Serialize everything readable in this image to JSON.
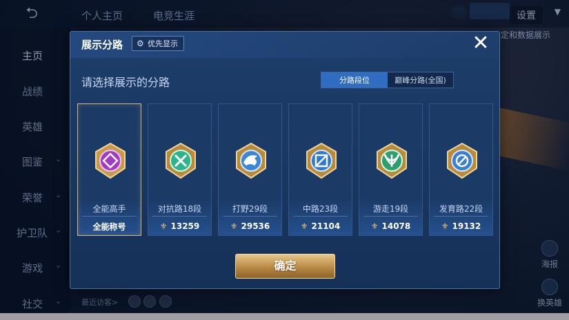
{
  "app": {
    "top_tabs": [
      "个人主页",
      "电竞生涯"
    ],
    "settings_label": "设置",
    "link_text": "定和数据展示",
    "sidebar": [
      {
        "label": "主页",
        "active": true,
        "chevron": false
      },
      {
        "label": "战绩",
        "chevron": false
      },
      {
        "label": "英雄",
        "chevron": false
      },
      {
        "label": "图鉴",
        "chevron": true
      },
      {
        "label": "荣誉",
        "chevron": true
      },
      {
        "label": "护卫队",
        "chevron": true
      },
      {
        "label": "游戏",
        "chevron": true
      },
      {
        "label": "社交",
        "chevron": true
      }
    ],
    "recent_visitors_label": "最近访客>",
    "right_tools": [
      "海报",
      "换英雄"
    ]
  },
  "modal": {
    "title": "展示分路",
    "priority_label": "优先显示",
    "priority_icon": "gear-icon",
    "close_icon": "close-icon",
    "subheading": "请选择展示的分路",
    "toggle": {
      "option_1": "分路段位",
      "option_2": "巅峰分路(全国)",
      "selected": "分路段位"
    },
    "cards": [
      {
        "label": "全能高手",
        "footer": "全能称号",
        "selected": true,
        "emblem_color": "#a23bbf",
        "icon": "all-round-emblem-icon"
      },
      {
        "label": "对抗路18段",
        "score": "13259",
        "emblem_color": "#2fb38a",
        "icon": "clash-lane-emblem-icon"
      },
      {
        "label": "打野29段",
        "score": "29536",
        "emblem_color": "#3d86d6",
        "icon": "jungle-emblem-icon"
      },
      {
        "label": "中路23段",
        "score": "21104",
        "emblem_color": "#2f78d0",
        "icon": "mid-lane-emblem-icon"
      },
      {
        "label": "游走19段",
        "score": "14078",
        "emblem_color": "#2e9e6e",
        "icon": "roam-emblem-icon"
      },
      {
        "label": "发育路22段",
        "score": "19132",
        "emblem_color": "#3a7fd4",
        "icon": "farm-lane-emblem-icon"
      }
    ],
    "confirm_label": "确定"
  },
  "colors": {
    "accent_gold": "#d7b47a",
    "toggle_active": "#2f6cc2",
    "panel": "#1e3f6c"
  }
}
